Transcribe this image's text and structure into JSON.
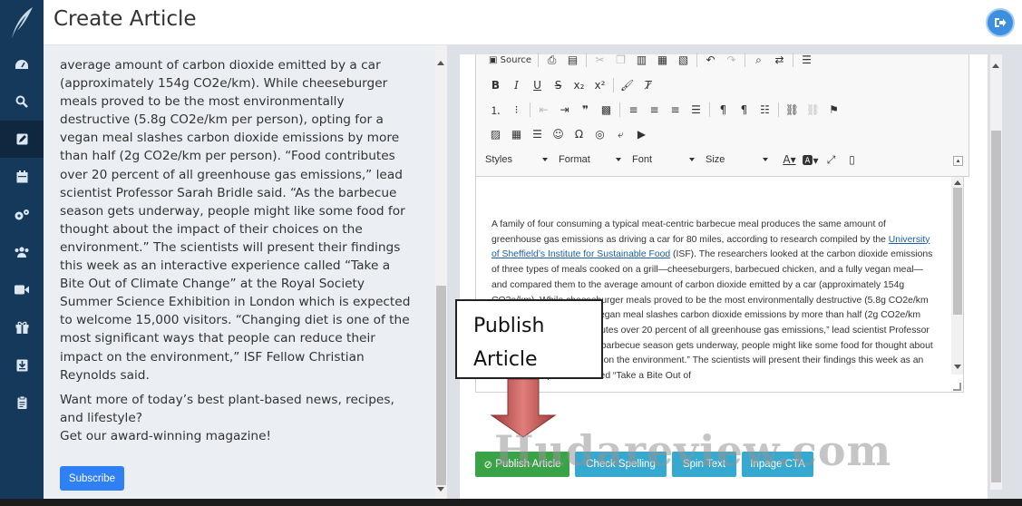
{
  "header": {
    "title": "Create Article"
  },
  "sidebar": {
    "items": [
      {
        "icon": "dashboard-icon",
        "active": false
      },
      {
        "icon": "search-icon",
        "active": false
      },
      {
        "icon": "edit-icon",
        "active": true
      },
      {
        "icon": "calendar-icon",
        "active": false
      },
      {
        "icon": "settings-icon",
        "active": false
      },
      {
        "icon": "users-icon",
        "active": false
      },
      {
        "icon": "video-icon",
        "active": false
      },
      {
        "icon": "gift-icon",
        "active": false
      },
      {
        "icon": "download-icon",
        "active": false
      },
      {
        "icon": "clipboard-icon",
        "active": false
      }
    ]
  },
  "preview": {
    "text": "average amount of carbon dioxide emitted by a car (approximately 154g CO2e/km). While cheeseburger meals proved to be the most environmentally destructive (5.8g CO2e/km per person), opting for a vegan meal slashes carbon dioxide emissions by more than half (2g CO2e/km per person). “Food contributes over 20 percent of all greenhouse gas emissions,” lead scientist Professor Sarah Bridle said. “As the barbecue season gets underway, people might like some food for thought about the impact of their choices on the environment.” The scientists will present their findings this week as an interactive experience called “Take a Bite Out of Climate Change” at the Royal Society Summer Science Exhibition in London which is expected to welcome 15,000 visitors. “Changing diet is one of the most significant ways that people can reduce their impact on the environment,” ISF Fellow Christian Reynolds said.",
    "promo_line1": "Want more of today’s best plant-based news, recipes, and lifestyle?",
    "promo_line2": "Get our award-winning magazine!",
    "subscribe_label": "Subscribe"
  },
  "toolbar": {
    "source_label": "Source",
    "styles_label": "Styles",
    "format_label": "Format",
    "font_label": "Font",
    "size_label": "Size"
  },
  "editor": {
    "text_before_link": "A family of four consuming a typical meat-centric barbecue meal produces the same amount of greenhouse gas emissions as driving a car for 80 miles, according to research compiled by the ",
    "link_text": "University of Sheffield’s Institute for Sustainable Food",
    "text_after_link": " (ISF). The researchers looked at the carbon dioxide emissions of three types of meals cooked on a grill—cheeseburgers, barbecued chicken, and a fully vegan meal—and compared them to the average amount of carbon dioxide emitted by a car (approximately 154g CO2e/km). While cheeseburger meals proved to be the most environmentally destructive (5.8g CO2e/km per person), opting for a vegan meal slashes carbon dioxide emissions by more than half (2g CO2e/km per person). “Food contributes over 20 percent of all greenhouse gas emissions,” lead scientist Professor Sarah Bridle said. “As the barbecue season gets underway, people might like some food for thought about the impact of their choices on the environment.” The scientists will present their findings this week as an interactive experience called “Take a Bite Out of"
  },
  "actions": {
    "publish_label": "Publish Article",
    "spelling_label": "Check Spelling",
    "spin_label": "Spin Text",
    "inpage_label": "Inpage CTA"
  },
  "callout": {
    "line1": "Publish",
    "line2": "Article"
  },
  "watermark": "Hudareview.com",
  "colors": {
    "sidebar": "#15395a",
    "accent_blue": "#2f7ff5",
    "publish_green": "#3aa348",
    "secondary_button": "#35a9cf",
    "arrow_red": "#c0504d"
  }
}
